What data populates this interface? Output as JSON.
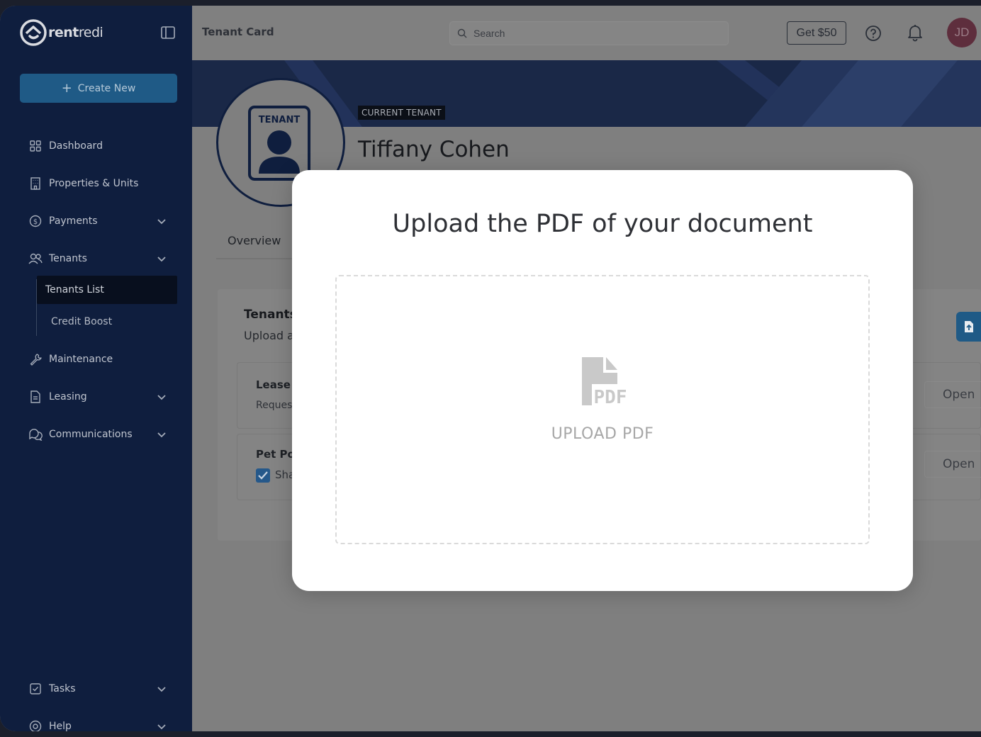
{
  "sidebar": {
    "logo_text_bold": "rent",
    "logo_text_light": "redi",
    "create_new_label": "Create New",
    "items": [
      {
        "label": "Dashboard"
      },
      {
        "label": "Properties & Units"
      },
      {
        "label": "Payments"
      },
      {
        "label": "Tenants"
      },
      {
        "label": "Maintenance"
      },
      {
        "label": "Leasing"
      },
      {
        "label": "Communications"
      },
      {
        "label": "Tasks"
      },
      {
        "label": "Help"
      }
    ],
    "tenants_sub": [
      {
        "label": "Tenants List",
        "active": true
      },
      {
        "label": "Credit Boost",
        "active": false
      }
    ]
  },
  "topbar": {
    "title": "Tenant Card",
    "search_placeholder": "Search",
    "promo_label": "Get $50",
    "avatar_initials": "JD"
  },
  "tenant": {
    "icon_label": "TENANT",
    "badge": "CURRENT TENANT",
    "name": "Tiffany Cohen"
  },
  "tabs": {
    "overview": "Overview"
  },
  "documents": {
    "title_partial": "Tenants",
    "subtitle_partial": "Upload a",
    "rows": [
      {
        "title_partial": "Lease",
        "sub_partial": "Reques",
        "open_label": "Open"
      },
      {
        "title_partial": "Pet Po",
        "sub_partial": "Sha",
        "open_label": "Open",
        "checked": true
      }
    ]
  },
  "modal": {
    "title": "Upload the PDF of your document",
    "upload_label": "UPLOAD PDF",
    "pdf_icon_text": "PDF"
  },
  "colors": {
    "sidebar_bg": "#0f1e3e",
    "accent": "#1f5a86",
    "banner": "#1a2847"
  }
}
